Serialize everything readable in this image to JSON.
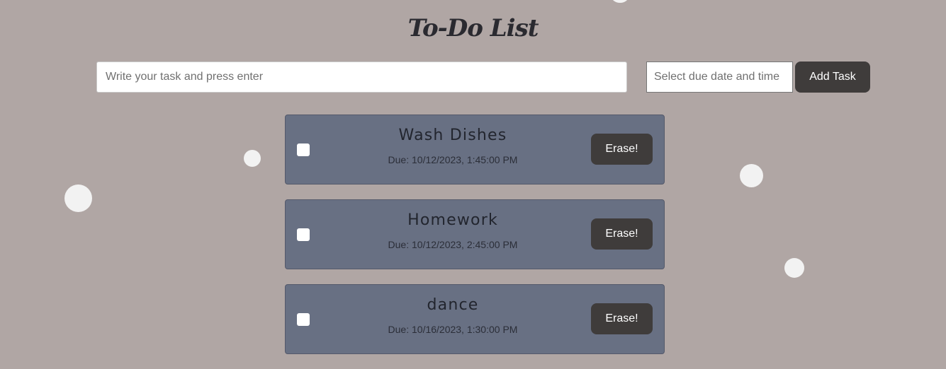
{
  "header": {
    "title": "To-Do List"
  },
  "form": {
    "task_placeholder": "Write your task and press enter",
    "date_placeholder": "Select due date and time",
    "add_label": "Add Task"
  },
  "tasks": [
    {
      "name": "Wash Dishes",
      "due": "Due: 10/12/2023, 1:45:00 PM",
      "erase_label": "Erase!",
      "checked": false
    },
    {
      "name": "Homework",
      "due": "Due: 10/12/2023, 2:45:00 PM",
      "erase_label": "Erase!",
      "checked": false
    },
    {
      "name": "dance",
      "due": "Due: 10/16/2023, 1:30:00 PM",
      "erase_label": "Erase!",
      "checked": false
    }
  ],
  "colors": {
    "background": "#b0a6a4",
    "card": "#687083",
    "button": "#3f3c3b",
    "bubble": "#f2f2f2"
  }
}
